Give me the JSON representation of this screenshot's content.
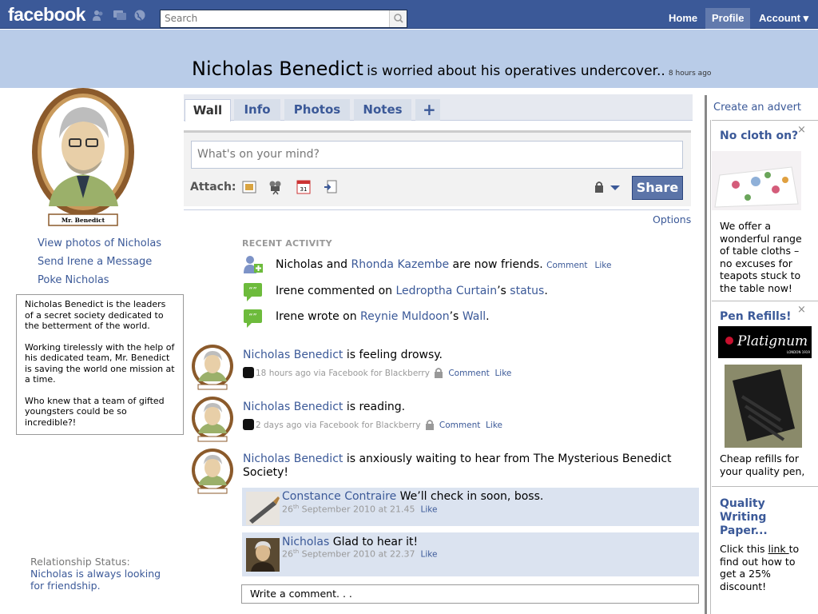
{
  "topbar": {
    "logo": "facebook",
    "search_placeholder": "Search",
    "nav": [
      "Home",
      "Profile",
      "Account ▾"
    ]
  },
  "header": {
    "name": "Nicholas Benedict",
    "status": "is worried about his operatives undercover..",
    "time": "8 hours ago"
  },
  "left": {
    "portrait_caption": "Mr. Benedict",
    "links": [
      "View photos of Nicholas",
      "Send Irene a Message",
      "Poke Nicholas"
    ],
    "bio": [
      "Nicholas Benedict is the leaders of a secret society dedicated to the betterment of the world.",
      "Working tirelessly with the help of his dedicated team, Mr. Benedict is saving the world one mission at a time.",
      "Who knew that a team of gifted youngsters could be so incredible?!"
    ],
    "relationship_label": "Relationship Status:",
    "relationship_value": "Nicholas is always looking for friendship."
  },
  "tabs": [
    "Wall",
    "Info",
    "Photos",
    "Notes",
    "+"
  ],
  "publisher": {
    "placeholder": "What's on your mind?",
    "attach_label": "Attach:",
    "share": "Share",
    "options": "Options"
  },
  "recent": {
    "heading": "RECENT ACTIVITY",
    "items": [
      {
        "pre": "Nicholas and ",
        "link1": "Rhonda Kazembe",
        "post": " are now friends.",
        "comment": "Comment",
        "like": "Like"
      },
      {
        "pre": "Irene commented on ",
        "link1": "Ledroptha Curtain",
        "mid": "’s ",
        "link2": "status",
        "post": "."
      },
      {
        "pre": "Irene wrote on ",
        "link1": "Reynie Muldoon",
        "mid": "’s ",
        "link2": "Wall",
        "post": "."
      }
    ]
  },
  "posts": [
    {
      "author": "Nicholas Benedict",
      "text": " is feeling drowsy.",
      "meta": "18 hours ago via Facebook for Blackberry",
      "comment": "Comment",
      "like": "Like"
    },
    {
      "author": "Nicholas Benedict",
      "text": " is reading.",
      "meta": "2 days ago via Facebook for Blackberry",
      "comment": "Comment",
      "like": "Like"
    },
    {
      "author": "Nicholas Benedict",
      "text": " is anxiously waiting to hear from The Mysterious Benedict Society!"
    }
  ],
  "comments": [
    {
      "author": "Constance Contraire",
      "text": " We’ll check in soon, boss.",
      "day": "26",
      "sup": "th",
      "date": " September 2010 at 21.45",
      "like": "Like"
    },
    {
      "author": "Nicholas",
      "text": " Glad to hear it!",
      "day": "26",
      "sup": "th",
      "date": " September 2010 at 22.37",
      "like": "Like"
    }
  ],
  "write_comment": "Write a comment. . .",
  "ads": {
    "create": "Create an advert",
    "items": [
      {
        "title": "No cloth on?",
        "close": "×",
        "text": "We offer a wonderful range of table cloths – no excuses for teapots stuck to the table now!"
      },
      {
        "title": "Pen Refills!",
        "close": "×",
        "logo": "Platignum",
        "logo_sub": "LONDON 1919",
        "text": "Cheap refills for your quality pen,"
      },
      {
        "title": "Quality Writing Paper...",
        "text_pre": "Click this ",
        "text_link": "link ",
        "text_post": "to find out how to get a 25% discount!"
      }
    ]
  },
  "colors": {
    "brand": "#3b5998",
    "header_band": "#b9cce8",
    "comment_bg": "#dbe3f0"
  }
}
